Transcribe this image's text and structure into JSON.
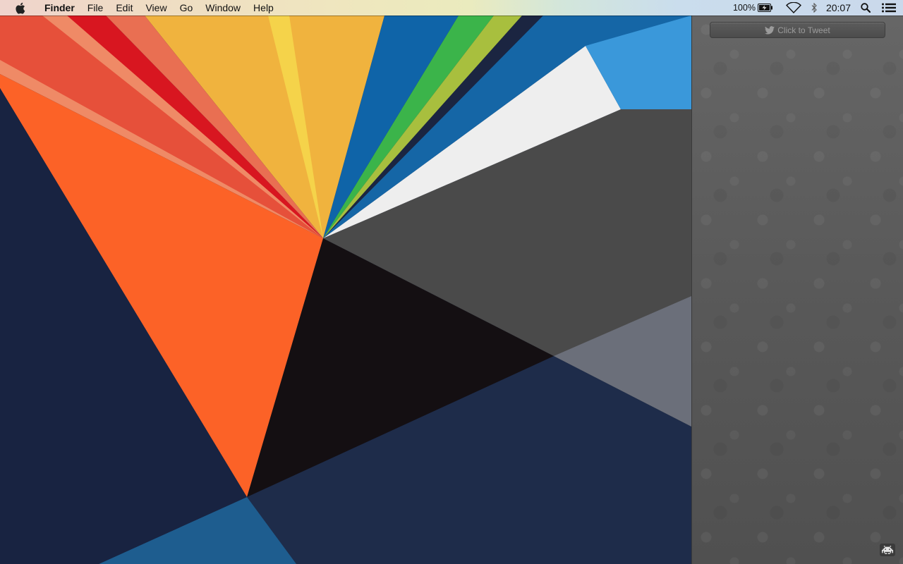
{
  "menubar": {
    "apple_icon": "apple-logo-icon",
    "app_name": "Finder",
    "menus": [
      "File",
      "Edit",
      "View",
      "Go",
      "Window",
      "Help"
    ],
    "status": {
      "battery_percent": "100%",
      "battery_icon": "battery-charging-icon",
      "wifi_icon": "wifi-icon",
      "bluetooth_icon": "bluetooth-icon",
      "time": "20:07",
      "spotlight_icon": "spotlight-search-icon",
      "notifications_icon": "notification-center-icon"
    }
  },
  "side_panel": {
    "tweet_button": {
      "label": "Click to Tweet",
      "icon": "twitter-bird-icon"
    },
    "corner_icon": "space-invader-icon"
  },
  "colors": {
    "wallpaper_navy": "#1b2541",
    "wallpaper_orange": "#fc6227",
    "wallpaper_red": "#d9121e",
    "wallpaper_yellow": "#f1b53a",
    "wallpaper_blue": "#1069aa",
    "wallpaper_green": "#3db544",
    "panel_gray": "#5e5e5e"
  }
}
